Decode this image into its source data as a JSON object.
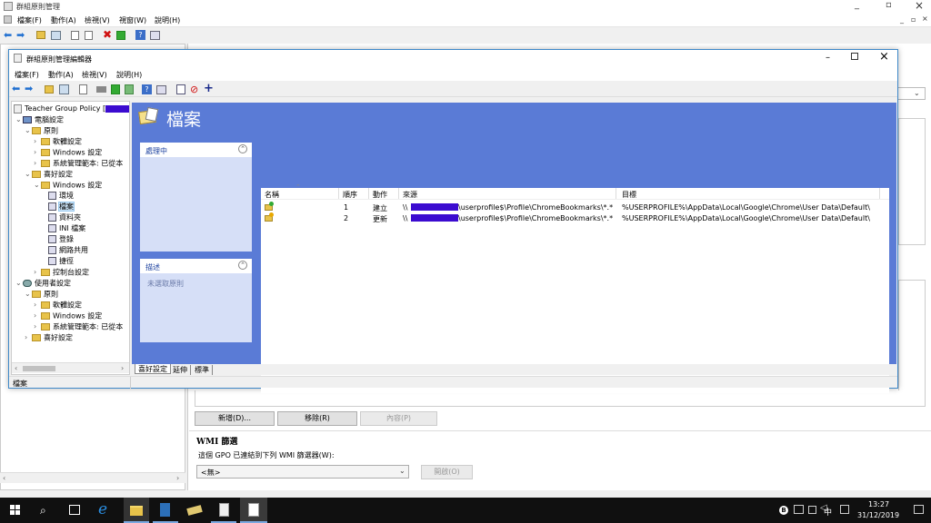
{
  "outer": {
    "title": "群組原則管理",
    "menu": [
      "檔案(F)",
      "動作(A)",
      "檢視(V)",
      "視窗(W)",
      "說明(H)"
    ],
    "min_icon": "_",
    "restore_icon": "▫",
    "close_icon": "×"
  },
  "editor": {
    "title": "群組原則管理編輯器",
    "menu": [
      "檔案(F)",
      "動作(A)",
      "檢視(V)",
      "說明(H)"
    ],
    "status": "檔案",
    "tree": [
      {
        "label": "Teacher Group Policy [",
        "indent": 0,
        "type": "policy"
      },
      {
        "label": "電腦設定",
        "indent": 1,
        "type": "computer",
        "expanded": true
      },
      {
        "label": "原則",
        "indent": 2,
        "type": "folder",
        "expanded": true
      },
      {
        "label": "軟體設定",
        "indent": 3,
        "type": "folder"
      },
      {
        "label": "Windows 設定",
        "indent": 3,
        "type": "folder"
      },
      {
        "label": "系統管理範本: 已從本",
        "indent": 3,
        "type": "folder"
      },
      {
        "label": "喜好設定",
        "indent": 2,
        "type": "folder",
        "expanded": true
      },
      {
        "label": "Windows 設定",
        "indent": 3,
        "type": "folder",
        "expanded": true
      },
      {
        "label": "環境",
        "indent": 4,
        "type": "item"
      },
      {
        "label": "檔案",
        "indent": 4,
        "type": "item",
        "selected": true
      },
      {
        "label": "資料夾",
        "indent": 4,
        "type": "item"
      },
      {
        "label": "INI 檔案",
        "indent": 4,
        "type": "item"
      },
      {
        "label": "登錄",
        "indent": 4,
        "type": "item"
      },
      {
        "label": "網路共用",
        "indent": 4,
        "type": "item"
      },
      {
        "label": "捷徑",
        "indent": 4,
        "type": "item"
      },
      {
        "label": "控制台設定",
        "indent": 3,
        "type": "folder"
      },
      {
        "label": "使用者設定",
        "indent": 1,
        "type": "user",
        "expanded": true
      },
      {
        "label": "原則",
        "indent": 2,
        "type": "folder",
        "expanded": true
      },
      {
        "label": "軟體設定",
        "indent": 3,
        "type": "folder"
      },
      {
        "label": "Windows 設定",
        "indent": 3,
        "type": "folder"
      },
      {
        "label": "系統管理範本: 已從本",
        "indent": 3,
        "type": "folder"
      },
      {
        "label": "喜好設定",
        "indent": 2,
        "type": "folder"
      }
    ],
    "pane_title": "檔案",
    "processing_title": "處理中",
    "description_title": "描述",
    "description_text": "未選取原則",
    "columns": [
      "名稱",
      "順序",
      "動作",
      "來源",
      "目標"
    ],
    "rows": [
      {
        "order": "1",
        "action": "建立",
        "source_pre": "\\\\",
        "source_post": "\\userprofile$\\Profile\\ChromeBookmarks\\*.*",
        "target": "%USERPROFILE%\\AppData\\Local\\Google\\Chrome\\User Data\\Default\\"
      },
      {
        "order": "2",
        "action": "更新",
        "source_pre": "\\\\",
        "source_post": "\\userprofile$\\Profile\\ChromeBookmarks\\*.*",
        "target": "%USERPROFILE%\\AppData\\Local\\Google\\Chrome\\User Data\\Default\\"
      }
    ],
    "tabs": [
      "喜好設定",
      "延伸",
      "標準"
    ]
  },
  "behind": {
    "add": "新增(D)...",
    "remove": "移除(R)",
    "properties": "內容(P)",
    "wmi_title": "WMI 篩選",
    "wmi_text": "這個 GPO 已連結到下列 WMI 篩選器(W):",
    "wmi_select": "<無>",
    "open": "開啟(O)"
  },
  "taskbar": {
    "time": "13:27",
    "date": "31/12/2019",
    "ime": "中"
  },
  "colors": {
    "pane_blue": "#5a7bd6",
    "panel_bg": "#d6dff7",
    "redact": "#3b0bd0"
  }
}
